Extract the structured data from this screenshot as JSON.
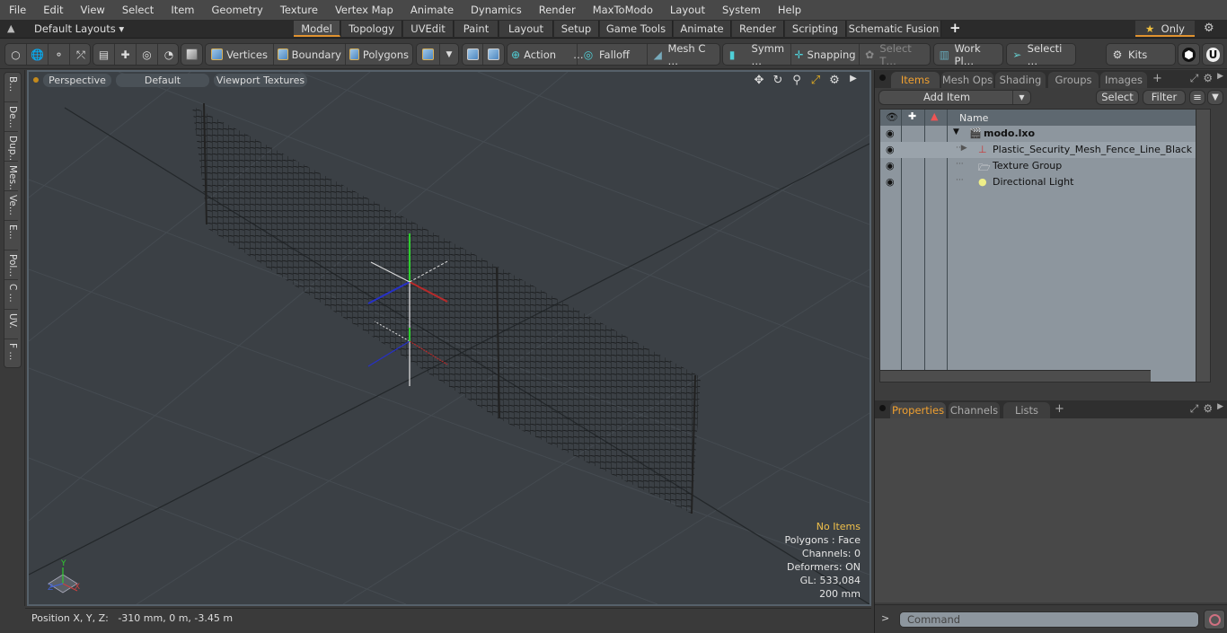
{
  "menu": [
    "File",
    "Edit",
    "View",
    "Select",
    "Item",
    "Geometry",
    "Texture",
    "Vertex Map",
    "Animate",
    "Dynamics",
    "Render",
    "MaxToModo",
    "Layout",
    "System",
    "Help"
  ],
  "layouts": {
    "dropdown_label": "Default Layouts ▾",
    "tabs": [
      "Model",
      "Topology",
      "UVEdit",
      "Paint",
      "Layout",
      "Setup",
      "Game Tools",
      "Animate",
      "Render",
      "Scripting",
      "Schematic Fusion"
    ],
    "active_tab": "Model",
    "add_label": "+",
    "only_label": "Only",
    "only_star": "★"
  },
  "toolbar": {
    "vertices": "Vertices",
    "boundary": "Boundary",
    "polygons": "Polygons",
    "action": "Action",
    "action_more": "…",
    "falloff": "Falloff",
    "mesh_c": "Mesh C …",
    "symm": "Symm …",
    "snapping": "Snapping",
    "select_t": "Select T…",
    "work_pl": "Work Pl…",
    "selecti": "Selecti …",
    "kits": "Kits"
  },
  "left_tabs": [
    "B...",
    "De...",
    "Dup...",
    "Mes...",
    "Ve...",
    "E...",
    "Pol...",
    "C ...",
    "UV.",
    "F ..."
  ],
  "viewport": {
    "view_label": "Perspective",
    "shading_label": "Default",
    "textures_label": "Viewport Textures",
    "info": {
      "selection": "No Items",
      "polygons": "Polygons : Face",
      "channels": "Channels: 0",
      "deformers": "Deformers: ON",
      "gl": "GL: 533,084",
      "scale": "200 mm"
    },
    "axes": {
      "x": "X",
      "y": "Y",
      "z": "Z"
    }
  },
  "status": {
    "position_label": "Position X, Y, Z:",
    "position_value": "-310 mm, 0 m, -3.45 m"
  },
  "items_panel": {
    "tabs": [
      "Items",
      "Mesh Ops",
      "Shading",
      "Groups",
      "Images"
    ],
    "active_tab": "Items",
    "add_tab": "+",
    "add_item": "Add Item",
    "select": "Select",
    "filter": "Filter",
    "column_name": "Name",
    "rows": [
      {
        "label": "modo.lxo",
        "type": "scene"
      },
      {
        "label": "Plastic_Security_Mesh_Fence_Line_Black",
        "type": "mesh"
      },
      {
        "label": "Texture Group",
        "type": "texture-group"
      },
      {
        "label": "Directional Light",
        "type": "light"
      }
    ]
  },
  "properties_panel": {
    "tabs": [
      "Properties",
      "Channels",
      "Lists"
    ],
    "active_tab": "Properties",
    "add_tab": "+"
  },
  "command": {
    "prompt": ">",
    "placeholder": "Command"
  }
}
